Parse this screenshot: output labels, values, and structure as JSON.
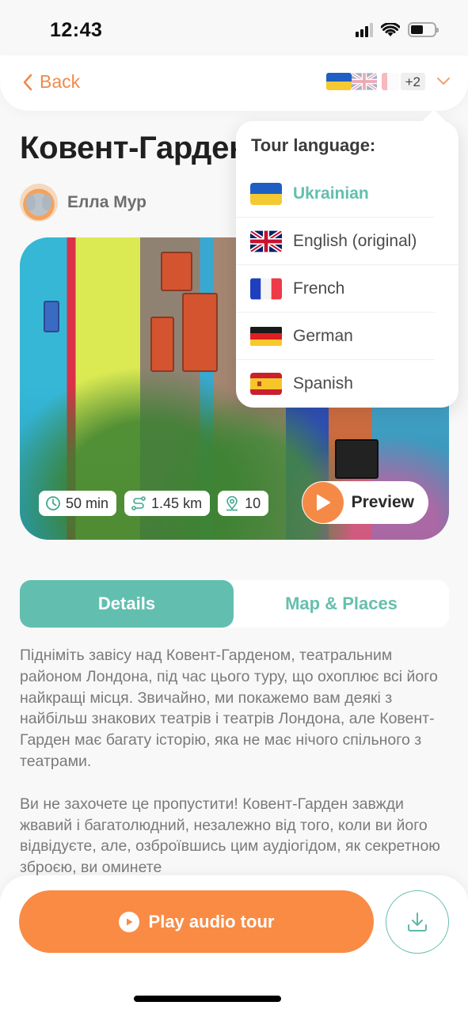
{
  "status_bar": {
    "time": "12:43"
  },
  "nav": {
    "back_label": "Back",
    "language_flags": [
      "ua",
      "gb",
      "fr"
    ],
    "more_languages_badge": "+2"
  },
  "tour": {
    "title": "Ковент-Гарден",
    "author_name": "Елла Мур",
    "stats": {
      "duration": "50 min",
      "distance": "1.45 km",
      "places": "10"
    },
    "preview_label": "Preview"
  },
  "tabs": [
    {
      "label": "Details",
      "active": true
    },
    {
      "label": "Map & Places",
      "active": false
    }
  ],
  "description": {
    "paragraphs": [
      "Підніміть завісу над Ковент-Гарденом, театральним районом Лондона, під час цього туру, що охоплює всі його найкращі місця. Звичайно, ми покажемо вам деякі з найбільш знакових театрів і театрів Лондона, але Ковент-Гарден має багату історію, яка не має нічого спільного з театрами.",
      "Ви не захочете це пропустити! Ковент-Гарден завжди жвавий і багатолюдний, незалежно від того, коли ви його відвідуєте, але, озброївшись цим аудіогідом, як секретною зброєю, ви оминете"
    ]
  },
  "bottom": {
    "play_label": "Play audio tour",
    "download_icon": "download-icon"
  },
  "language_dropdown": {
    "title": "Tour language:",
    "selected": "Ukrainian",
    "options": [
      {
        "code": "ua",
        "label": "Ukrainian"
      },
      {
        "code": "gb",
        "label": "English (original)"
      },
      {
        "code": "fr",
        "label": "French"
      },
      {
        "code": "de",
        "label": "German"
      },
      {
        "code": "es",
        "label": "Spanish"
      }
    ]
  },
  "colors": {
    "accent_orange": "#f98b45",
    "accent_teal": "#62bfb0",
    "text_gray": "#7a7a7a"
  }
}
